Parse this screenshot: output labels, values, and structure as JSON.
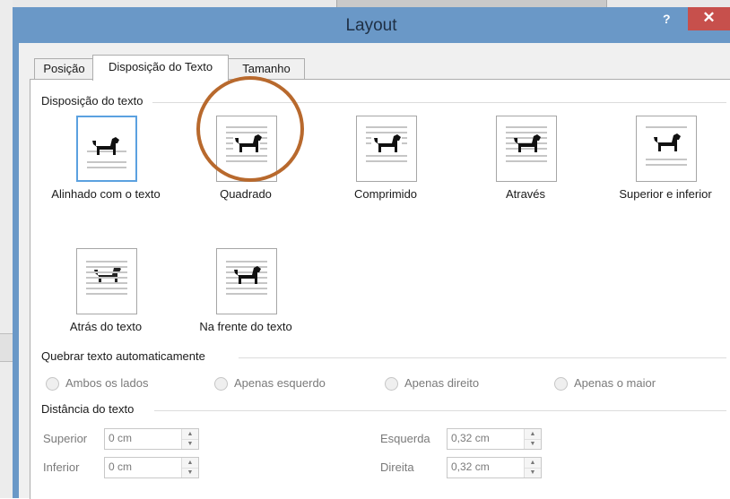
{
  "window": {
    "title": "Layout",
    "help_label": "?",
    "close_label": "✕"
  },
  "tabs": [
    {
      "label": "Posição",
      "active": false
    },
    {
      "label": "Disposição do Texto",
      "active": true
    },
    {
      "label": "Tamanho",
      "active": false
    }
  ],
  "wrap_section": {
    "heading": "Disposição do texto",
    "options": [
      {
        "label": "Alinhado com o texto",
        "icon": "inline-with-text-icon",
        "selected": true
      },
      {
        "label": "Quadrado",
        "icon": "square-wrap-icon",
        "selected": false
      },
      {
        "label": "Comprimido",
        "icon": "tight-wrap-icon",
        "selected": false
      },
      {
        "label": "Através",
        "icon": "through-wrap-icon",
        "selected": false
      },
      {
        "label": "Superior e inferior",
        "icon": "top-bottom-wrap-icon",
        "selected": false
      },
      {
        "label": "Atrás do texto",
        "icon": "behind-text-icon",
        "selected": false
      },
      {
        "label": "Na frente do texto",
        "icon": "in-front-of-text-icon",
        "selected": false
      }
    ]
  },
  "wrap_text_section": {
    "heading": "Quebrar texto automaticamente",
    "options": [
      "Ambos os lados",
      "Apenas esquerdo",
      "Apenas direito",
      "Apenas o maior"
    ]
  },
  "distance_section": {
    "heading": "Distância do texto",
    "fields": [
      {
        "label": "Superior",
        "value": "0 cm"
      },
      {
        "label": "Inferior",
        "value": "0 cm"
      },
      {
        "label": "Esquerda",
        "value": "0,32 cm"
      },
      {
        "label": "Direita",
        "value": "0,32 cm"
      }
    ]
  },
  "colors": {
    "titlebar": "#6a98c7",
    "close_button": "#c7504c",
    "selection": "#5ba1e0",
    "annotation_circle": "#b8692d"
  }
}
